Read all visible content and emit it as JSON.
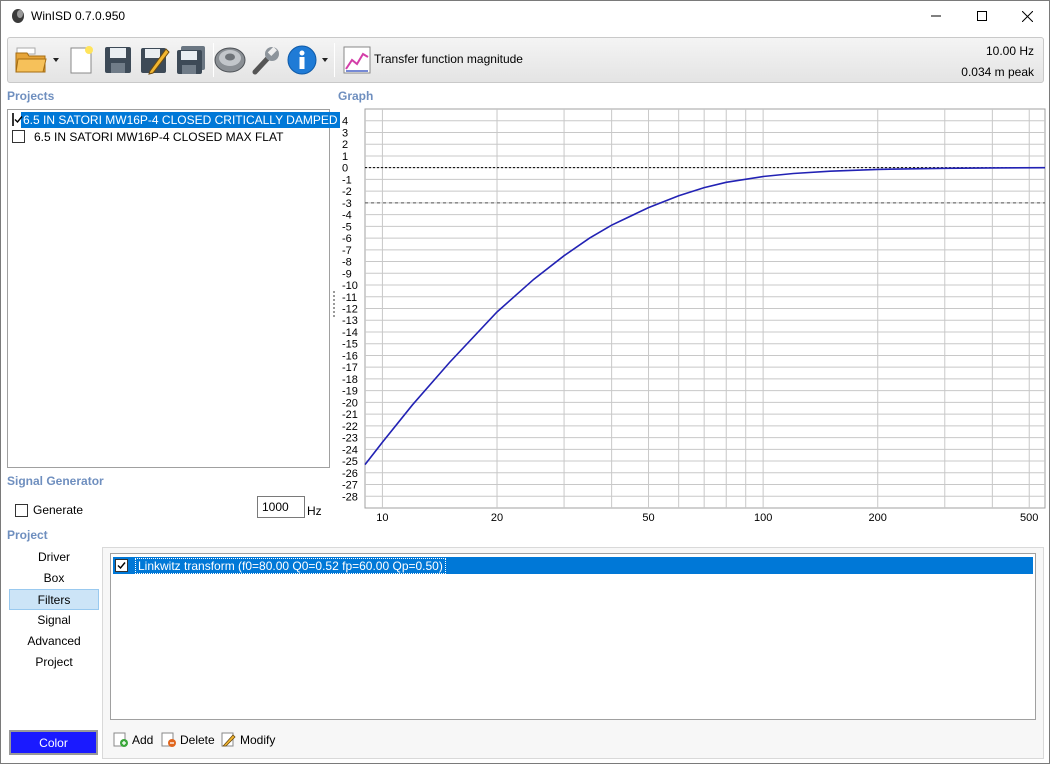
{
  "window": {
    "title": "WinISD 0.7.0.950"
  },
  "toolbar": {
    "graph_type_label": "Transfer function magnitude",
    "cursor_frequency": "10.00 Hz",
    "cursor_value": "0.034 m peak",
    "icons": [
      "open-icon",
      "new-icon",
      "save-icon",
      "edit-save-icon",
      "save-all-icon",
      "driver-icon",
      "wrench-icon",
      "info-icon",
      "graph-icon"
    ]
  },
  "sections": {
    "projects": "Projects",
    "graph": "Graph",
    "signal_generator": "Signal Generator",
    "project": "Project"
  },
  "projects": [
    {
      "name": "6.5 IN SATORI MW16P-4 CLOSED CRITICALLY DAMPED",
      "checked": true,
      "selected": true
    },
    {
      "name": "6.5 IN SATORI MW16P-4 CLOSED MAX FLAT",
      "checked": false,
      "selected": false
    }
  ],
  "signal": {
    "generate_label": "Generate",
    "frequency": "1000",
    "unit": "Hz"
  },
  "nav": {
    "items": [
      "Driver",
      "Box",
      "Filters",
      "Signal",
      "Advanced",
      "Project"
    ],
    "active": "Filters"
  },
  "color_button": {
    "label": "Color",
    "color": "#1a1aff"
  },
  "filters": [
    {
      "label": "Linkwitz transform (f0=80.00 Q0=0.52 fp=60.00 Qp=0.50)",
      "checked": true
    }
  ],
  "actions": {
    "add": "Add",
    "delete": "Delete",
    "modify": "Modify"
  },
  "chart_data": {
    "type": "line",
    "title": "",
    "xlabel": "",
    "ylabel": "",
    "x_scale": "log",
    "xlim": [
      9,
      550
    ],
    "ylim": [
      -29,
      5
    ],
    "x_ticks": [
      10,
      20,
      50,
      100,
      200,
      500
    ],
    "y_ticks": [
      4,
      3,
      2,
      1,
      0,
      -1,
      -2,
      -3,
      -4,
      -5,
      -6,
      -7,
      -8,
      -9,
      -10,
      -11,
      -12,
      -13,
      -14,
      -15,
      -16,
      -17,
      -18,
      -19,
      -20,
      -21,
      -22,
      -23,
      -24,
      -25,
      -26,
      -27,
      -28
    ],
    "reference_lines": [
      0,
      -3
    ],
    "grid": true,
    "series": [
      {
        "color": "#2222b4",
        "x": [
          9,
          10,
          12,
          15,
          20,
          25,
          30,
          35,
          40,
          50,
          60,
          70,
          80,
          100,
          120,
          150,
          200,
          300,
          400,
          550
        ],
        "y": [
          -25.3,
          -23.4,
          -20.2,
          -16.6,
          -12.3,
          -9.5,
          -7.5,
          -6.0,
          -4.9,
          -3.4,
          -2.4,
          -1.7,
          -1.25,
          -0.75,
          -0.5,
          -0.3,
          -0.15,
          -0.05,
          -0.02,
          0
        ]
      }
    ]
  }
}
